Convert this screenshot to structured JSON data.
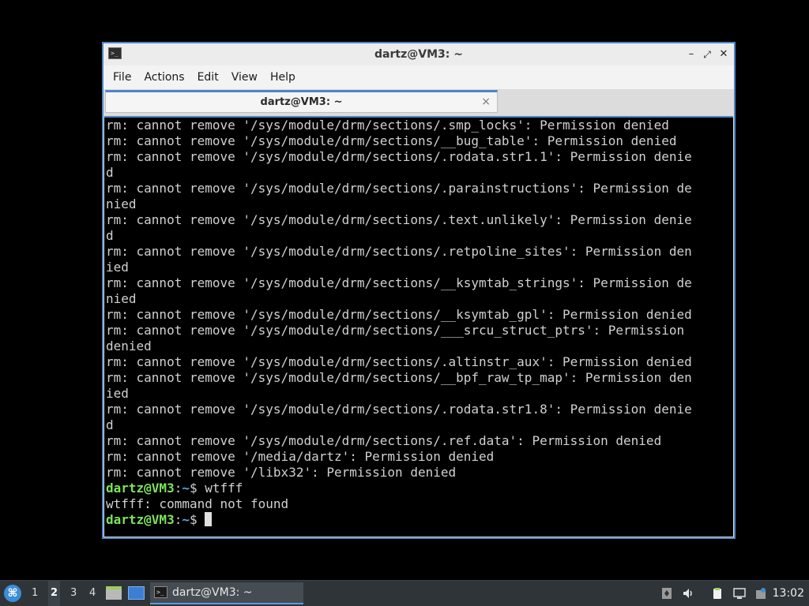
{
  "window": {
    "title": "dartz@VM3: ~",
    "buttons": {
      "minimize": "–",
      "maximize": "⤢",
      "close": "✕"
    }
  },
  "menu": {
    "items": [
      {
        "label": "File"
      },
      {
        "label": "Actions"
      },
      {
        "label": "Edit"
      },
      {
        "label": "View"
      },
      {
        "label": "Help"
      }
    ]
  },
  "tab": {
    "label": "dartz@VM3: ~",
    "close": "×"
  },
  "terminal": {
    "lines": [
      "rm: cannot remove '/sys/module/drm/sections/.smp_locks': Permission denied",
      "rm: cannot remove '/sys/module/drm/sections/__bug_table': Permission denied",
      "rm: cannot remove '/sys/module/drm/sections/.rodata.str1.1': Permission denie",
      "d",
      "rm: cannot remove '/sys/module/drm/sections/.parainstructions': Permission de",
      "nied",
      "rm: cannot remove '/sys/module/drm/sections/.text.unlikely': Permission denie",
      "d",
      "rm: cannot remove '/sys/module/drm/sections/.retpoline_sites': Permission den",
      "ied",
      "rm: cannot remove '/sys/module/drm/sections/__ksymtab_strings': Permission de",
      "nied",
      "rm: cannot remove '/sys/module/drm/sections/__ksymtab_gpl': Permission denied",
      "rm: cannot remove '/sys/module/drm/sections/___srcu_struct_ptrs': Permission",
      "denied",
      "rm: cannot remove '/sys/module/drm/sections/.altinstr_aux': Permission denied",
      "rm: cannot remove '/sys/module/drm/sections/__bpf_raw_tp_map': Permission den",
      "ied",
      "rm: cannot remove '/sys/module/drm/sections/.rodata.str1.8': Permission denie",
      "d",
      "rm: cannot remove '/sys/module/drm/sections/.ref.data': Permission denied",
      "rm: cannot remove '/media/dartz': Permission denied",
      "rm: cannot remove '/libx32': Permission denied"
    ],
    "prompt": {
      "user": "dartz@VM3",
      "sep": ":",
      "path": "~",
      "symbol": "$ "
    },
    "command": "wtfff",
    "error_line": "wtfff: command not found"
  },
  "taskbar": {
    "workspaces": [
      "1",
      "2",
      "3",
      "4"
    ],
    "active_workspace": "2",
    "task_label": "dartz@VM3: ~",
    "clock": "13:02"
  },
  "colors": {
    "accent": "#4f86c6",
    "prompt_user": "#7ce35a",
    "prompt_path": "#6a9fe6",
    "terminal_bg": "#000000",
    "terminal_fg": "#d0d0d0"
  }
}
